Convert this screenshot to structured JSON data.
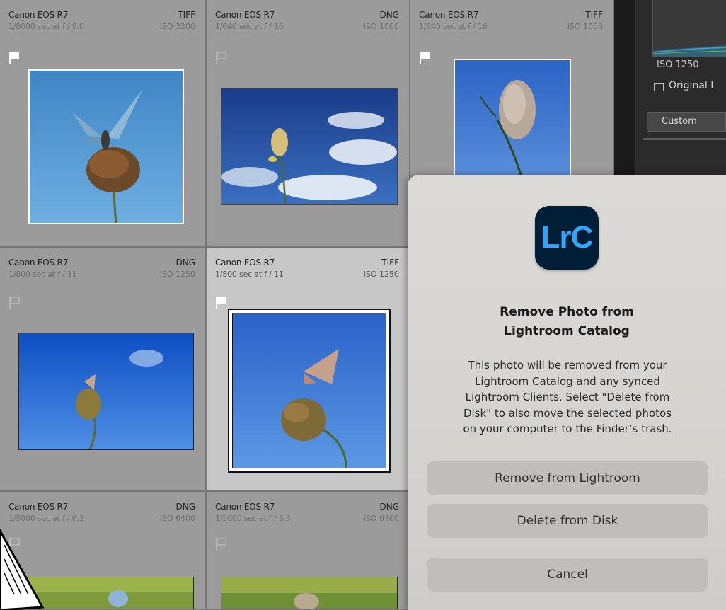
{
  "grid": {
    "cells": [
      {
        "camera": "Canon EOS R7",
        "format": "TIFF",
        "exposure": "1/8000 sec at f / 9.0",
        "iso": "ISO 3200",
        "flag": "white"
      },
      {
        "camera": "Canon EOS R7",
        "format": "DNG",
        "exposure": "1/640 sec at f / 16",
        "iso": "ISO 1000",
        "flag": "outline"
      },
      {
        "camera": "Canon EOS R7",
        "format": "TIFF",
        "exposure": "1/640 sec at f / 16",
        "iso": "ISO 1000",
        "flag": "white"
      },
      {
        "camera": "Canon EOS R7",
        "format": "DNG",
        "exposure": "1/800 sec at f / 11",
        "iso": "ISO 1250",
        "flag": "outline"
      },
      {
        "camera": "Canon EOS R7",
        "format": "TIFF",
        "exposure": "1/800 sec at f / 11",
        "iso": "ISO 1250",
        "flag": "white",
        "selected": true
      },
      {
        "camera": "Canon EOS R7",
        "format": "DNG",
        "exposure": "1/5000 sec at f / 6.3",
        "iso": "ISO 6400",
        "flag": "outline"
      },
      {
        "camera": "Canon EOS R7",
        "format": "DNG",
        "exposure": "1/5000 sec at f / 6.3",
        "iso": "ISO 6400",
        "flag": "outline"
      }
    ]
  },
  "right_panel": {
    "iso_readout": "ISO 1250",
    "original_label": "Original I",
    "profile_value": "Custom"
  },
  "dialog": {
    "app_icon_text": "LrC",
    "title_line1": "Remove Photo from",
    "title_line2": "Lightroom Catalog",
    "body_lines": [
      "This photo will be removed from your",
      "Lightroom Catalog and any synced",
      "Lightroom Clients. Select \"Delete from",
      "Disk\" to also move the selected photos",
      "on your computer to the Finder’s trash."
    ],
    "buttons": {
      "remove": "Remove from Lightroom",
      "delete": "Delete from Disk",
      "cancel": "Cancel"
    }
  },
  "colors": {
    "lrc_icon_bg": "#001e36",
    "lrc_icon_text": "#31a8ff",
    "dialog_bg": "#d8d6d3",
    "button_bg": "#bfbebc"
  }
}
